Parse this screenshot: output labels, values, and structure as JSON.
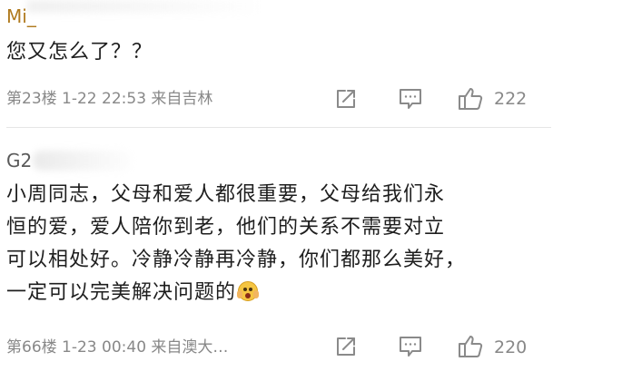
{
  "comments": [
    {
      "username": "Mi_",
      "text": "您又怎么了？？",
      "meta": "第23楼 1-22 22:53 来自吉林",
      "likes": "222"
    },
    {
      "username": "G2",
      "text": "小周同志，父母和爱人都很重要，父母给我们永\n恒的爱，爱人陪你到老，他们的关系不需要对立\n可以相处好。冷静冷静再冷静，你们都那么美好，\n一定可以完美解决问题的",
      "meta": "第66楼 1-23 00:40 来自澳大…",
      "likes": "220"
    }
  ],
  "icons": {
    "share": "share-icon",
    "comment": "comment-icon",
    "like": "thumbs-up-icon",
    "emoji": "scared-face-emoji-icon"
  },
  "colors": {
    "username_first": "#b07a1e",
    "username_second": "#5a5a5a",
    "meta": "#888888",
    "text": "#1e1e1e",
    "icon": "#8a8a8a"
  }
}
